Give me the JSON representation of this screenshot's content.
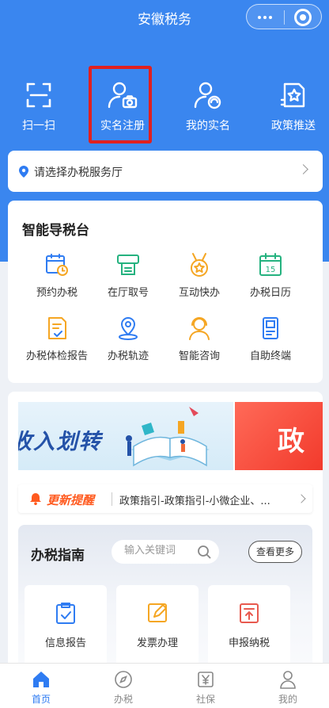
{
  "app": {
    "title": "安徽税务"
  },
  "quick_actions": [
    {
      "label": "扫一扫",
      "icon": "scan-icon"
    },
    {
      "label": "实名注册",
      "icon": "user-camera-icon"
    },
    {
      "label": "我的实名",
      "icon": "user-badge-icon"
    },
    {
      "label": "政策推送",
      "icon": "document-star-icon"
    }
  ],
  "hall_selector": {
    "text": "请选择办税服务厅"
  },
  "smart_guide": {
    "title": "智能导税台",
    "items": [
      {
        "label": "预约办税",
        "icon": "calendar-clock-icon"
      },
      {
        "label": "在厅取号",
        "icon": "ticket-machine-icon"
      },
      {
        "label": "互动快办",
        "icon": "medal-icon"
      },
      {
        "label": "办税日历",
        "icon": "calendar-15-icon"
      },
      {
        "label": "办税体检报告",
        "icon": "report-check-icon"
      },
      {
        "label": "办税轨迹",
        "icon": "location-pin-icon"
      },
      {
        "label": "智能咨询",
        "icon": "headset-agent-icon"
      },
      {
        "label": "自助终端",
        "icon": "kiosk-icon"
      }
    ]
  },
  "banners": [
    {
      "text": "收入划转"
    },
    {
      "text": "政"
    }
  ],
  "notice": {
    "tag": "更新提醒",
    "text": "政策指引-政策指引-小微企业、..."
  },
  "tax_guide": {
    "title": "办税指南",
    "search_placeholder": "输入关键词",
    "more_label": "查看更多",
    "tiles": [
      {
        "label": "信息报告",
        "icon": "info-report-icon"
      },
      {
        "label": "发票办理",
        "icon": "invoice-edit-icon"
      },
      {
        "label": "申报纳税",
        "icon": "tax-declare-icon"
      }
    ]
  },
  "tabbar": [
    {
      "label": "首页",
      "icon": "home-icon",
      "active": true
    },
    {
      "label": "办税",
      "icon": "compass-icon"
    },
    {
      "label": "社保",
      "icon": "yen-card-icon"
    },
    {
      "label": "我的",
      "icon": "person-icon"
    }
  ],
  "colors": {
    "primary": "#3a86ef",
    "highlight": "#e0201f",
    "accent_orange": "#ff5a1f"
  }
}
